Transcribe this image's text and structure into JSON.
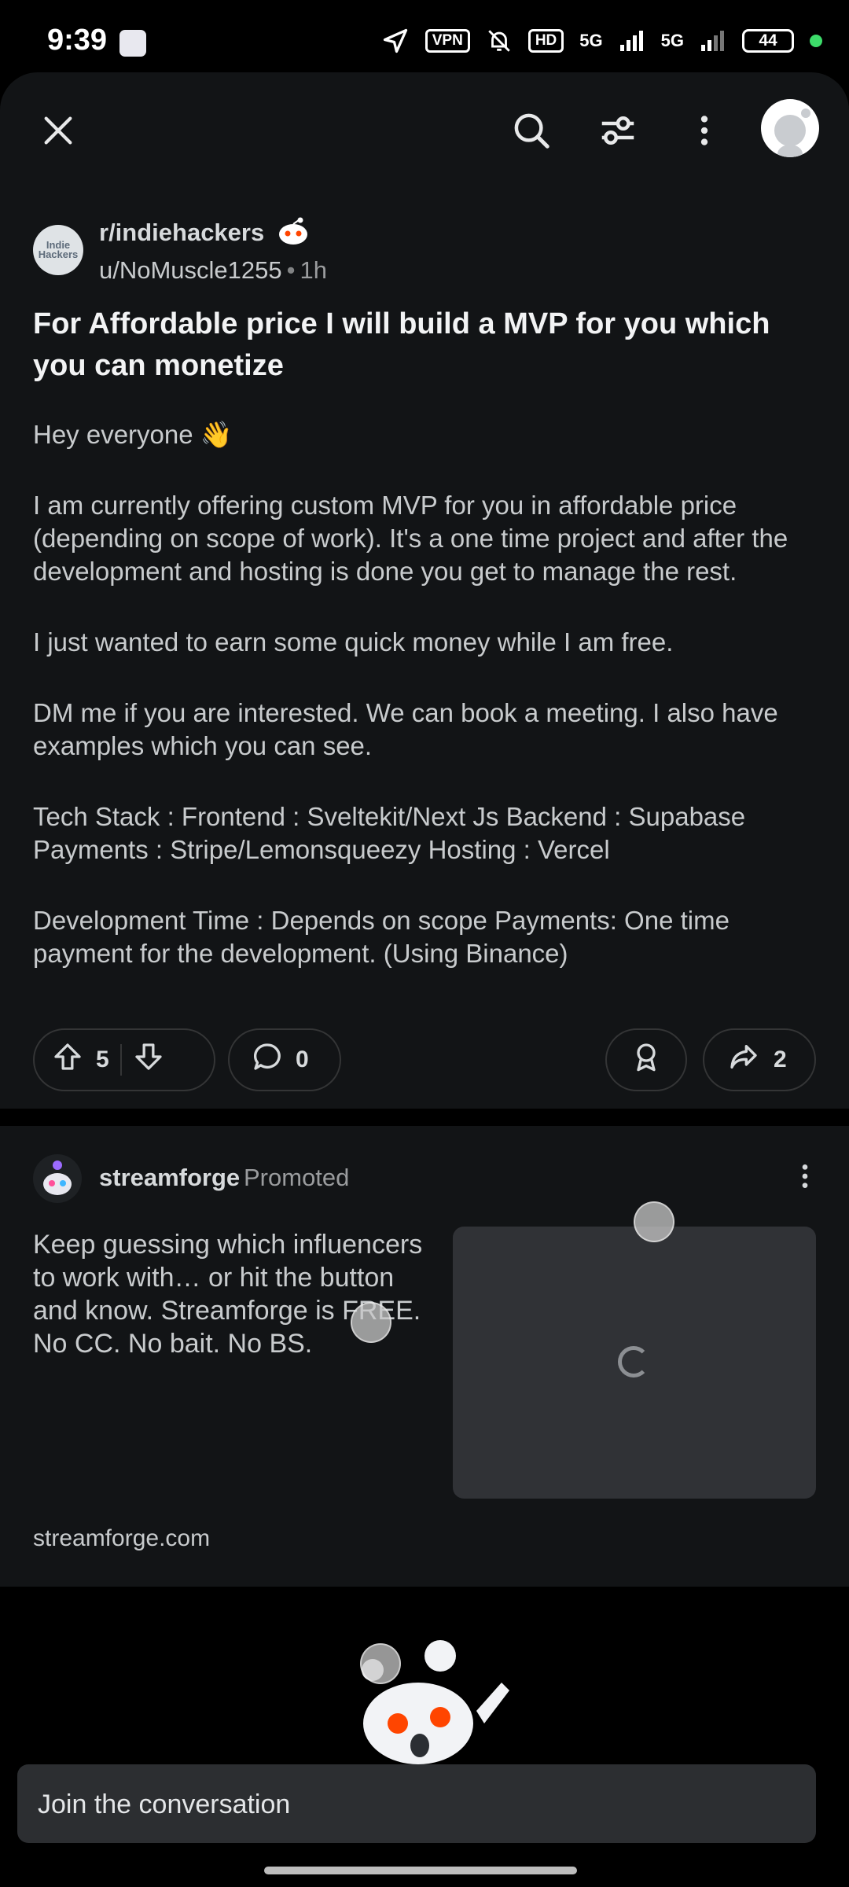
{
  "status_bar": {
    "time": "9:39",
    "vpn": "VPN",
    "hd": "HD",
    "net1": "5G",
    "net2": "5G",
    "battery": "44"
  },
  "toolbar": {
    "close_icon": "close-icon",
    "search_icon": "search-icon",
    "filter_icon": "filter-icon",
    "more_icon": "more-vertical-icon"
  },
  "post": {
    "subreddit": "r/indiehackers",
    "subreddit_avatar_text": "Indie Hackers",
    "author": "u/NoMuscle1255",
    "age": "1h",
    "title": "For Affordable price I will build a MVP for you which you can monetize",
    "body": [
      "Hey everyone 👋",
      "I am currently offering custom MVP for you in affordable price (depending on scope of work). It's a one time project and after the development and hosting is done you get to manage the rest.",
      "I just wanted to earn some quick money while I am free.",
      "DM me if you are interested. We can book a meeting. I also have examples which you can see.",
      "Tech Stack : Frontend : Sveltekit/Next Js Backend : Supabase Payments : Stripe/Lemonsqueezy Hosting : Vercel",
      "Development Time : Depends on scope Payments: One time payment for the development. (Using Binance)"
    ],
    "upvotes": "5",
    "comments": "0",
    "shares": "2"
  },
  "promoted": {
    "name": "streamforge",
    "label": "Promoted",
    "text": "Keep guessing which influencers to work with… or hit the button and know. Streamforge is FREE. No CC. No bait. No BS.",
    "domain": "streamforge.com"
  },
  "composer": {
    "placeholder": "Join the conversation"
  },
  "colors": {
    "background": "#121416",
    "accent": "#ff4500",
    "pill_border": "#343536"
  }
}
